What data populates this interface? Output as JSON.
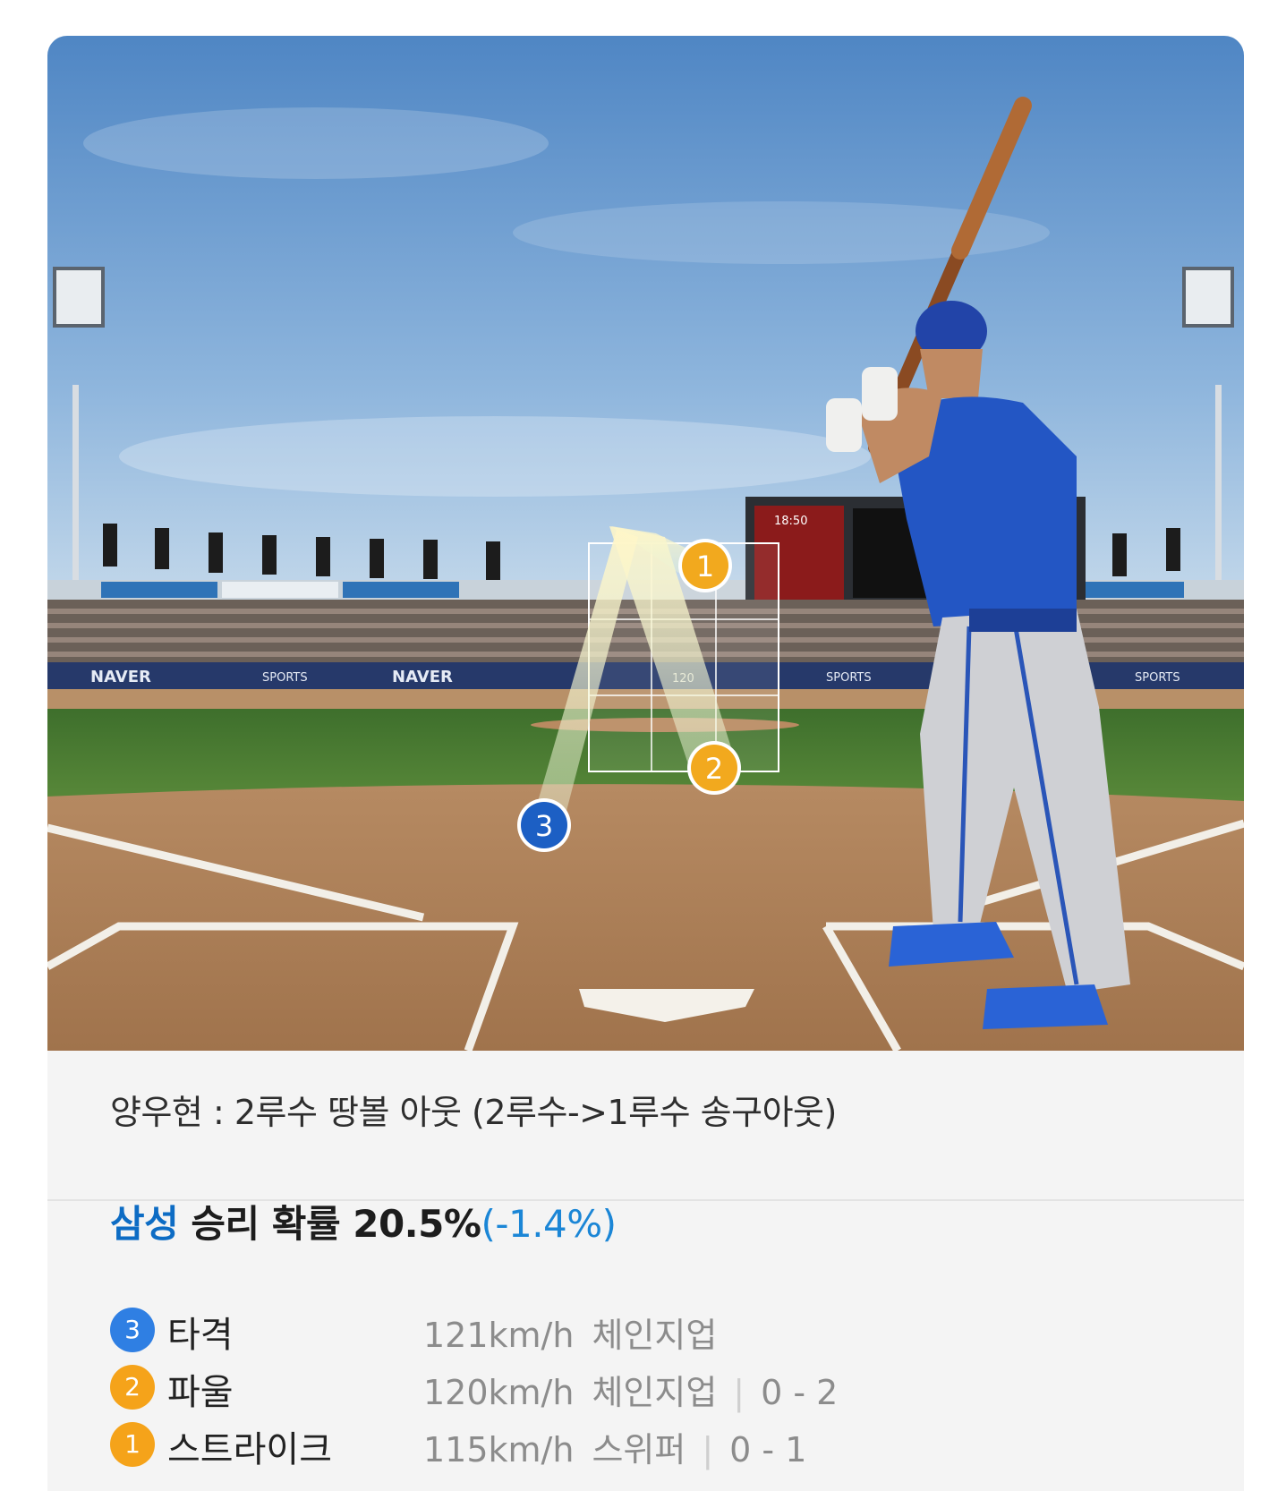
{
  "scene": {
    "board_labels": [
      "NAVER",
      "SPORTS",
      "NAVER",
      "SPORTS",
      "SPORTS",
      "SPORTS"
    ],
    "scoreboard_time": "18:50",
    "zone_speed_label": "120",
    "markers": [
      {
        "num": "1",
        "color": "#f2a91e"
      },
      {
        "num": "2",
        "color": "#f2a91e"
      },
      {
        "num": "3",
        "color": "#1c5fc4"
      }
    ]
  },
  "result": {
    "text": "양우현 : 2루수 땅볼 아웃 (2루수->1루수 송구아웃)"
  },
  "win_prob": {
    "team": "삼성",
    "label": "승리 확률",
    "value": "20.5%",
    "delta": "(-1.4%)"
  },
  "pitches": [
    {
      "num": "3",
      "badge_color": "#2f7fe3",
      "type": "타격",
      "speed": "121km/h",
      "pitch": "체인지업",
      "count": ""
    },
    {
      "num": "2",
      "badge_color": "#f5a31a",
      "type": "파울",
      "speed": "120km/h",
      "pitch": "체인지업",
      "count": "0 - 2"
    },
    {
      "num": "1",
      "badge_color": "#f5a31a",
      "type": "스트라이크",
      "speed": "115km/h",
      "pitch": "스위퍼",
      "count": "0 - 1"
    }
  ]
}
